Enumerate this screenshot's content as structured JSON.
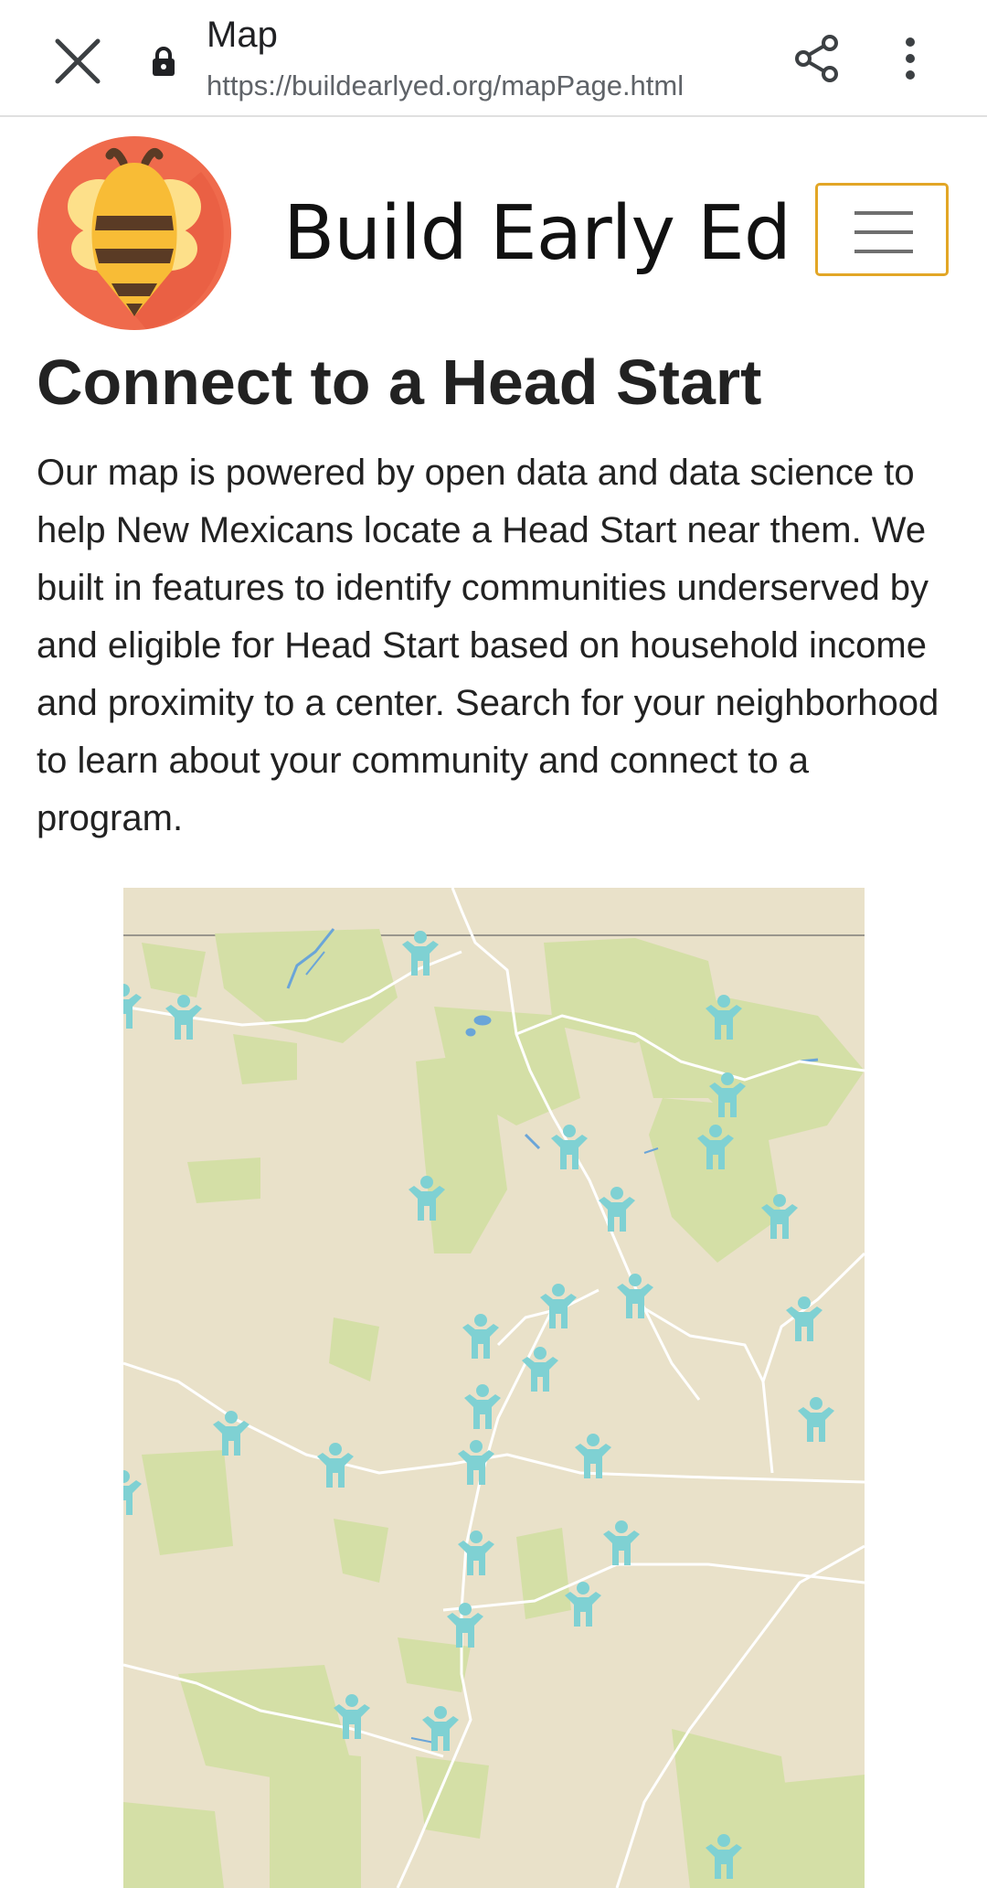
{
  "browser": {
    "title": "Map",
    "url": "https://buildearlyed.org/mapPage.html",
    "icons": [
      "close-icon",
      "lock-icon",
      "share-icon",
      "more-vert-icon"
    ]
  },
  "site": {
    "title": "Build Early Ed",
    "logo": "bee-logo",
    "menu_icon": "hamburger-icon",
    "menu_border_color": "#e2a626"
  },
  "content": {
    "heading": "Connect to a Head Start",
    "intro": "Our map is powered by open data and data science to help New Mexicans locate a Head Start near them. We built in features to identify communities underserved by and eligible for Head Start based on household income and proximity to a center. Search for your neighborhood to learn about your community and connect to a program."
  },
  "map": {
    "marker_icon": "child-marker-icon",
    "marker_color": "#7fd1d3",
    "land_color": "#e9e1c9",
    "forest_color": "#d4dfa6",
    "road_color": "#ffffff",
    "water_color": "#6aa5d8"
  }
}
